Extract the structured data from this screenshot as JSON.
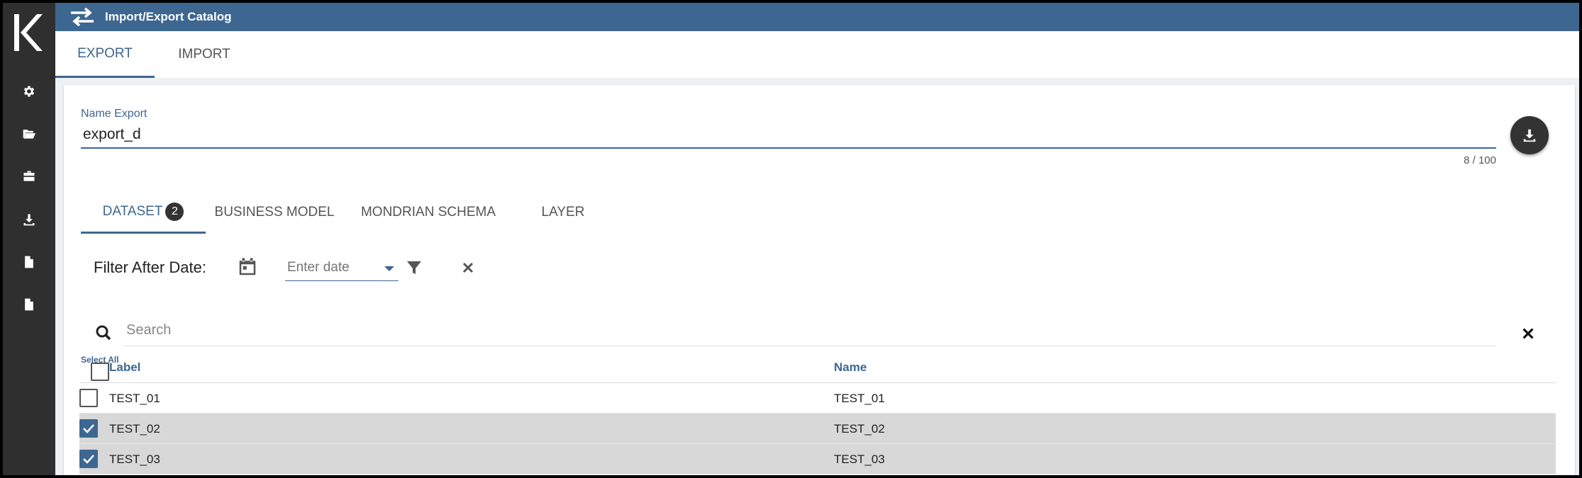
{
  "app": {
    "title": "Import/Export Catalog"
  },
  "colors": {
    "accent": "#3d6790",
    "sidebar": "#2f2f2f",
    "selected_row": "#d8d8d8"
  },
  "sidebar": {
    "items": [
      {
        "icon": "gear-icon"
      },
      {
        "icon": "folder-open-icon"
      },
      {
        "icon": "briefcase-icon"
      },
      {
        "icon": "download-icon"
      },
      {
        "icon": "file-icon"
      },
      {
        "icon": "file-icon"
      }
    ]
  },
  "main_tabs": [
    {
      "label": "EXPORT",
      "active": true
    },
    {
      "label": "IMPORT",
      "active": false
    }
  ],
  "export_form": {
    "name_label": "Name Export",
    "name_value": "export_d",
    "counter": "8 / 100"
  },
  "sub_tabs": [
    {
      "label": "DATASET",
      "badge": "2",
      "active": true
    },
    {
      "label": "BUSINESS MODEL",
      "active": false
    },
    {
      "label": "MONDRIAN SCHEMA",
      "active": false
    },
    {
      "label": "LAYER",
      "active": false
    }
  ],
  "filter": {
    "label": "Filter After Date:",
    "date_placeholder": "Enter date"
  },
  "search": {
    "placeholder": "Search"
  },
  "table": {
    "select_all_label": "Select All",
    "columns": [
      "Label",
      "Name"
    ],
    "rows": [
      {
        "label": "TEST_01",
        "name": "TEST_01",
        "checked": false
      },
      {
        "label": "TEST_02",
        "name": "TEST_02",
        "checked": true
      },
      {
        "label": "TEST_03",
        "name": "TEST_03",
        "checked": true
      }
    ]
  }
}
